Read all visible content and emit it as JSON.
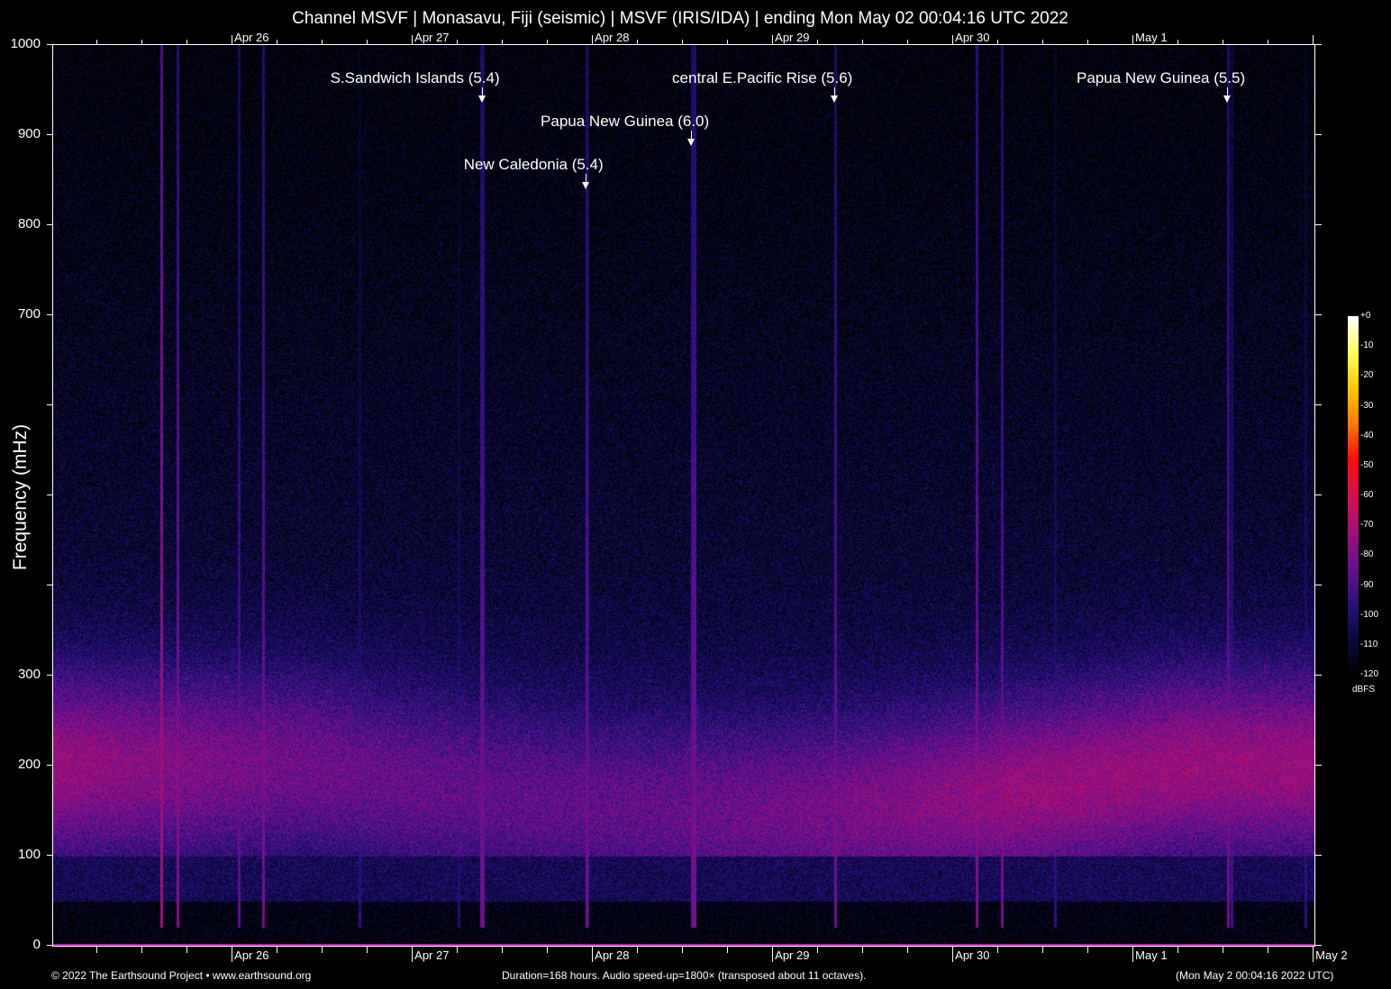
{
  "title": "Channel MSVF | Monasavu, Fiji (seismic) | MSVF (IRIS/IDA) | ending Mon May 02 00:04:16 UTC 2022",
  "chart_data": {
    "type": "heatmap",
    "title": "Channel MSVF | Monasavu, Fiji (seismic) | MSVF (IRIS/IDA) | ending Mon May 02 00:04:16 UTC 2022",
    "ylabel": "Frequency (mHz)",
    "ylim": [
      0,
      1000
    ],
    "yticks": [
      0,
      100,
      200,
      300,
      400,
      500,
      600,
      700,
      800,
      900,
      1000
    ],
    "ytick_labels": [
      "0",
      "100",
      "200",
      "300",
      "",
      "",
      "",
      "700",
      "800",
      "900",
      "1000"
    ],
    "xlim_hours": [
      0,
      168
    ],
    "xticks": [
      {
        "label": "Apr 26",
        "hours": 23.9
      },
      {
        "label": "Apr 27",
        "hours": 47.9
      },
      {
        "label": "Apr 28",
        "hours": 71.9
      },
      {
        "label": "Apr 29",
        "hours": 95.9
      },
      {
        "label": "Apr 30",
        "hours": 119.9
      },
      {
        "label": "May  1",
        "hours": 143.9
      },
      {
        "label": "May  2",
        "hours": 167.9
      }
    ],
    "colorbar": {
      "label": "dBFS",
      "ticks": [
        "+0",
        "-10",
        "-20",
        "-30",
        "-40",
        "-50",
        "-60",
        "-70",
        "-80",
        "-90",
        "-100",
        "-110",
        "-120"
      ],
      "range": [
        -120,
        0
      ],
      "colors": [
        "#000000",
        "#0a0a40",
        "#2a1080",
        "#6a1090",
        "#a0107a",
        "#d8104a",
        "#ff0a0a",
        "#ff7a00",
        "#ffc800",
        "#ffff60",
        "#ffffff"
      ]
    },
    "events": [
      {
        "label": "S.Sandwich Islands (5.4)",
        "hours": 57.2
      },
      {
        "label": "New Caledonia (5.4)",
        "hours": 71.0
      },
      {
        "label": "Papua New Guinea (6.0)",
        "hours": 85.1
      },
      {
        "label": "central E.Pacific Rise (5.6)",
        "hours": 104.2
      },
      {
        "label": "Papua New Guinea (5.5)",
        "hours": 156.5
      }
    ]
  },
  "footer": {
    "copyright": "© 2022 The Earthsound Project • www.earthsound.org",
    "info": "Duration=168 hours. Audio speed-up=1800× (transposed about 11 octaves).",
    "end": "(Mon May  2 00:04:16 2022 UTC)"
  }
}
